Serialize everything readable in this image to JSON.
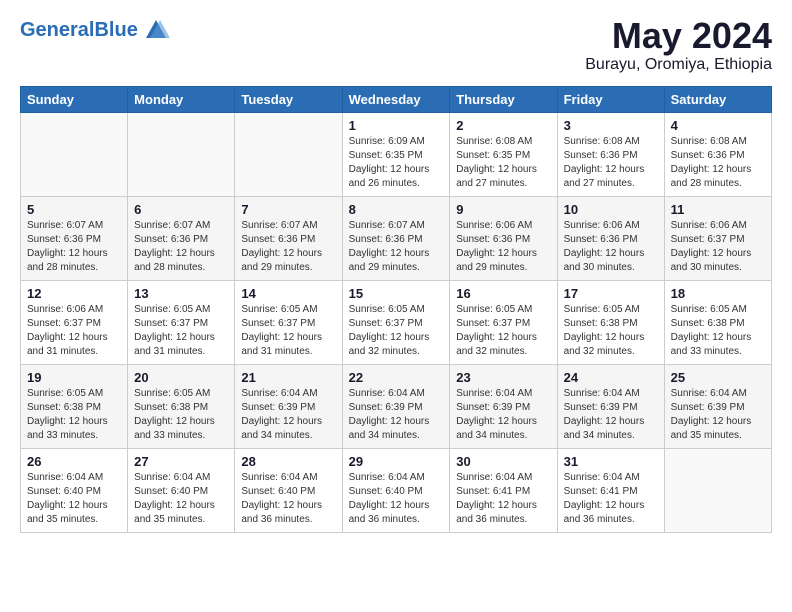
{
  "header": {
    "logo_text_general": "General",
    "logo_text_blue": "Blue",
    "title": "May 2024",
    "subtitle": "Burayu, Oromiya, Ethiopia"
  },
  "calendar": {
    "days_of_week": [
      "Sunday",
      "Monday",
      "Tuesday",
      "Wednesday",
      "Thursday",
      "Friday",
      "Saturday"
    ],
    "weeks": [
      [
        {
          "day": "",
          "info": ""
        },
        {
          "day": "",
          "info": ""
        },
        {
          "day": "",
          "info": ""
        },
        {
          "day": "1",
          "info": "Sunrise: 6:09 AM\nSunset: 6:35 PM\nDaylight: 12 hours\nand 26 minutes."
        },
        {
          "day": "2",
          "info": "Sunrise: 6:08 AM\nSunset: 6:35 PM\nDaylight: 12 hours\nand 27 minutes."
        },
        {
          "day": "3",
          "info": "Sunrise: 6:08 AM\nSunset: 6:36 PM\nDaylight: 12 hours\nand 27 minutes."
        },
        {
          "day": "4",
          "info": "Sunrise: 6:08 AM\nSunset: 6:36 PM\nDaylight: 12 hours\nand 28 minutes."
        }
      ],
      [
        {
          "day": "5",
          "info": "Sunrise: 6:07 AM\nSunset: 6:36 PM\nDaylight: 12 hours\nand 28 minutes."
        },
        {
          "day": "6",
          "info": "Sunrise: 6:07 AM\nSunset: 6:36 PM\nDaylight: 12 hours\nand 28 minutes."
        },
        {
          "day": "7",
          "info": "Sunrise: 6:07 AM\nSunset: 6:36 PM\nDaylight: 12 hours\nand 29 minutes."
        },
        {
          "day": "8",
          "info": "Sunrise: 6:07 AM\nSunset: 6:36 PM\nDaylight: 12 hours\nand 29 minutes."
        },
        {
          "day": "9",
          "info": "Sunrise: 6:06 AM\nSunset: 6:36 PM\nDaylight: 12 hours\nand 29 minutes."
        },
        {
          "day": "10",
          "info": "Sunrise: 6:06 AM\nSunset: 6:36 PM\nDaylight: 12 hours\nand 30 minutes."
        },
        {
          "day": "11",
          "info": "Sunrise: 6:06 AM\nSunset: 6:37 PM\nDaylight: 12 hours\nand 30 minutes."
        }
      ],
      [
        {
          "day": "12",
          "info": "Sunrise: 6:06 AM\nSunset: 6:37 PM\nDaylight: 12 hours\nand 31 minutes."
        },
        {
          "day": "13",
          "info": "Sunrise: 6:05 AM\nSunset: 6:37 PM\nDaylight: 12 hours\nand 31 minutes."
        },
        {
          "day": "14",
          "info": "Sunrise: 6:05 AM\nSunset: 6:37 PM\nDaylight: 12 hours\nand 31 minutes."
        },
        {
          "day": "15",
          "info": "Sunrise: 6:05 AM\nSunset: 6:37 PM\nDaylight: 12 hours\nand 32 minutes."
        },
        {
          "day": "16",
          "info": "Sunrise: 6:05 AM\nSunset: 6:37 PM\nDaylight: 12 hours\nand 32 minutes."
        },
        {
          "day": "17",
          "info": "Sunrise: 6:05 AM\nSunset: 6:38 PM\nDaylight: 12 hours\nand 32 minutes."
        },
        {
          "day": "18",
          "info": "Sunrise: 6:05 AM\nSunset: 6:38 PM\nDaylight: 12 hours\nand 33 minutes."
        }
      ],
      [
        {
          "day": "19",
          "info": "Sunrise: 6:05 AM\nSunset: 6:38 PM\nDaylight: 12 hours\nand 33 minutes."
        },
        {
          "day": "20",
          "info": "Sunrise: 6:05 AM\nSunset: 6:38 PM\nDaylight: 12 hours\nand 33 minutes."
        },
        {
          "day": "21",
          "info": "Sunrise: 6:04 AM\nSunset: 6:39 PM\nDaylight: 12 hours\nand 34 minutes."
        },
        {
          "day": "22",
          "info": "Sunrise: 6:04 AM\nSunset: 6:39 PM\nDaylight: 12 hours\nand 34 minutes."
        },
        {
          "day": "23",
          "info": "Sunrise: 6:04 AM\nSunset: 6:39 PM\nDaylight: 12 hours\nand 34 minutes."
        },
        {
          "day": "24",
          "info": "Sunrise: 6:04 AM\nSunset: 6:39 PM\nDaylight: 12 hours\nand 34 minutes."
        },
        {
          "day": "25",
          "info": "Sunrise: 6:04 AM\nSunset: 6:39 PM\nDaylight: 12 hours\nand 35 minutes."
        }
      ],
      [
        {
          "day": "26",
          "info": "Sunrise: 6:04 AM\nSunset: 6:40 PM\nDaylight: 12 hours\nand 35 minutes."
        },
        {
          "day": "27",
          "info": "Sunrise: 6:04 AM\nSunset: 6:40 PM\nDaylight: 12 hours\nand 35 minutes."
        },
        {
          "day": "28",
          "info": "Sunrise: 6:04 AM\nSunset: 6:40 PM\nDaylight: 12 hours\nand 36 minutes."
        },
        {
          "day": "29",
          "info": "Sunrise: 6:04 AM\nSunset: 6:40 PM\nDaylight: 12 hours\nand 36 minutes."
        },
        {
          "day": "30",
          "info": "Sunrise: 6:04 AM\nSunset: 6:41 PM\nDaylight: 12 hours\nand 36 minutes."
        },
        {
          "day": "31",
          "info": "Sunrise: 6:04 AM\nSunset: 6:41 PM\nDaylight: 12 hours\nand 36 minutes."
        },
        {
          "day": "",
          "info": ""
        }
      ]
    ]
  }
}
